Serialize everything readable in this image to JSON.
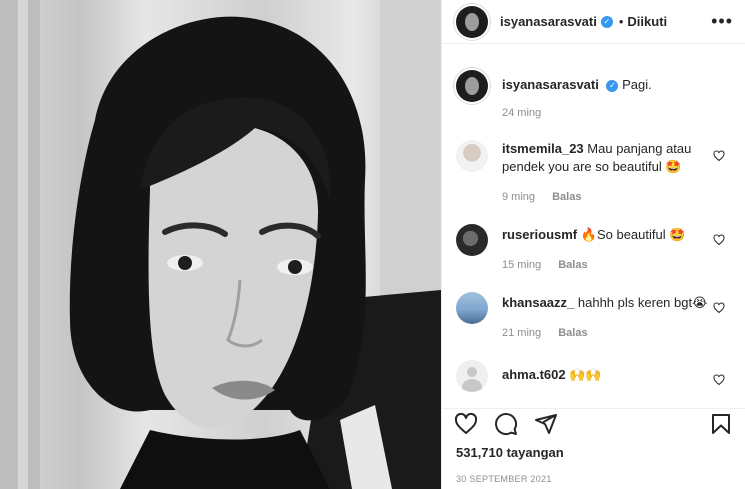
{
  "header": {
    "username": "isyanasarasvati",
    "separator": "•",
    "follow_status": "Diikuti",
    "more": "•••"
  },
  "caption": {
    "username": "isyanasarasvati",
    "text": "Pagi.",
    "time": "24 ming"
  },
  "comments": [
    {
      "username": "itsmemila_23",
      "text": "Mau panjang atau pendek you are so beautiful 🤩",
      "time": "9 ming",
      "reply": "Balas"
    },
    {
      "username": "ruseriousmf",
      "text": "🔥So beautiful 🤩",
      "time": "15 ming",
      "reply": "Balas"
    },
    {
      "username": "khansaazz_",
      "text": "hahhh pls keren bgt😭",
      "time": "21 ming",
      "reply": "Balas"
    },
    {
      "username": "ahma.t602",
      "text": "🙌🙌",
      "time": "",
      "reply": ""
    }
  ],
  "stats": {
    "views": "531,710 tayangan",
    "date": "30 SEPTEMBER 2021"
  }
}
